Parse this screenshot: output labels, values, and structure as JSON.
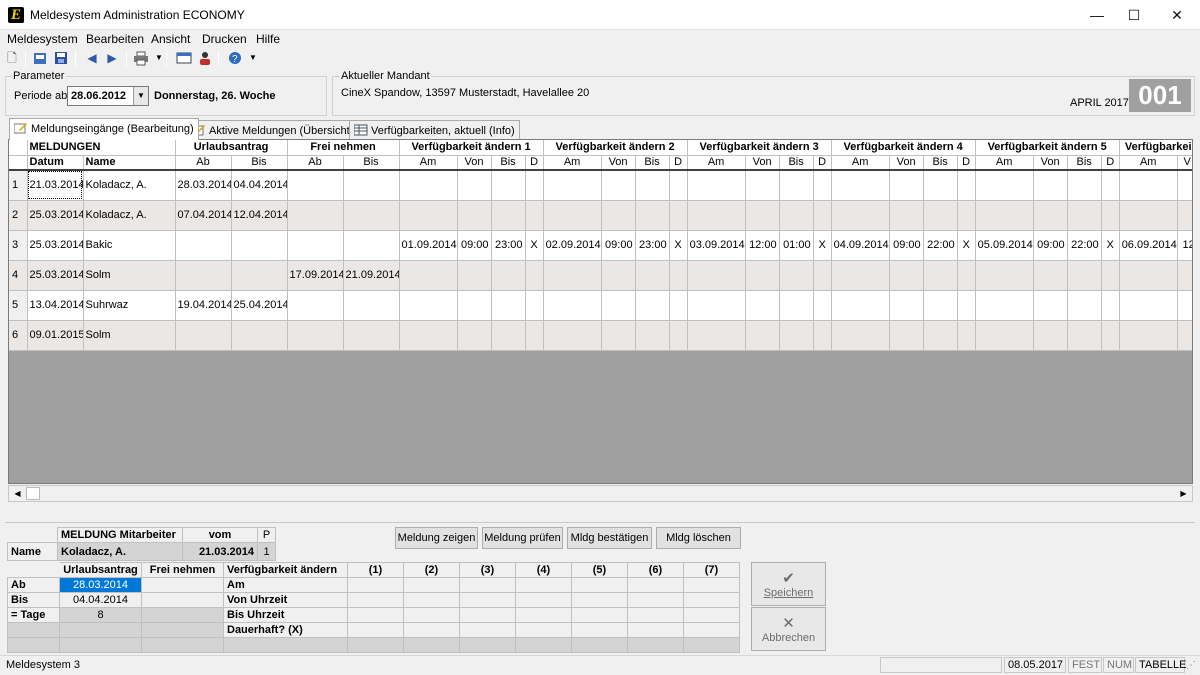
{
  "window": {
    "title": "Meldesystem Administration ECONOMY",
    "logo_letter": "E",
    "min": "—",
    "max": "☐",
    "close": "✕"
  },
  "menu": [
    "Meldesystem",
    "Bearbeiten",
    "Ansicht",
    "Drucken",
    "Hilfe"
  ],
  "parameter": {
    "group_label": "Parameter",
    "periode_label": "Periode ab",
    "periode_value": "28.06.2012",
    "periode_info": "Donnerstag, 26. Woche"
  },
  "mandant": {
    "group_label": "Aktueller Mandant",
    "text": "CineX Spandow, 13597 Musterstadt, Havelallee 20",
    "month": "APRIL 2017",
    "badge": "001"
  },
  "tabs": [
    {
      "label": "Meldungseingänge (Bearbeitung)",
      "active": true
    },
    {
      "label": "Aktive Meldungen (Übersicht)",
      "active": false
    },
    {
      "label": "Verfügbarkeiten, aktuell (Info)",
      "active": false
    }
  ],
  "grid": {
    "group_headers": [
      "MELDUNGEN",
      "Urlaubsantrag",
      "Frei nehmen",
      "Verfügbarkeit ändern 1",
      "Verfügbarkeit ändern 2",
      "Verfügbarkeit ändern 3",
      "Verfügbarkeit ändern 4",
      "Verfügbarkeit ändern 5",
      "Verfügbarkei"
    ],
    "sub_headers": {
      "datum": "Datum",
      "name": "Name",
      "ab": "Ab",
      "bis": "Bis",
      "am": "Am",
      "von": "Von",
      "d": "D",
      "partial": "V"
    },
    "rows": [
      {
        "n": "1",
        "datum": "21.03.2014",
        "name": "Koladacz, A.",
        "u_ab": "28.03.2014",
        "u_bis": "04.04.2014",
        "f_ab": "",
        "f_bis": "",
        "v": []
      },
      {
        "n": "2",
        "datum": "25.03.2014",
        "name": "Koladacz, A.",
        "u_ab": "07.04.2014",
        "u_bis": "12.04.2014",
        "f_ab": "",
        "f_bis": "",
        "v": []
      },
      {
        "n": "3",
        "datum": "25.03.2014",
        "name": "Bakic",
        "u_ab": "",
        "u_bis": "",
        "f_ab": "",
        "f_bis": "",
        "v": [
          [
            "01.09.2014",
            "09:00",
            "23:00",
            "X"
          ],
          [
            "02.09.2014",
            "09:00",
            "23:00",
            "X"
          ],
          [
            "03.09.2014",
            "12:00",
            "01:00",
            "X"
          ],
          [
            "04.09.2014",
            "09:00",
            "22:00",
            "X"
          ],
          [
            "05.09.2014",
            "09:00",
            "22:00",
            "X"
          ],
          [
            "06.09.2014",
            "12",
            "",
            ""
          ]
        ]
      },
      {
        "n": "4",
        "datum": "25.03.2014",
        "name": "Solm",
        "u_ab": "",
        "u_bis": "",
        "f_ab": "17.09.2014",
        "f_bis": "21.09.2014",
        "v": []
      },
      {
        "n": "5",
        "datum": "13.04.2014",
        "name": "Suhrwaz",
        "u_ab": "19.04.2014",
        "u_bis": "25.04.2014",
        "f_ab": "",
        "f_bis": "",
        "v": []
      },
      {
        "n": "6",
        "datum": "09.01.2015",
        "name": "Solm",
        "u_ab": "",
        "u_bis": "",
        "f_ab": "",
        "f_bis": "",
        "v": []
      }
    ]
  },
  "detail": {
    "mitarbeiter_header": "MELDUNG Mitarbeiter",
    "vom_header": "vom",
    "p_header": "P",
    "name_label": "Name",
    "name_value": "Koladacz, A.",
    "vom_value": "21.03.2014",
    "p_value": "1",
    "buttons": [
      "Meldung zeigen",
      "Meldung prüfen",
      "Mldg bestätigen",
      "Mldg löschen"
    ],
    "col_urlaub": "Urlaubsantrag",
    "col_frei": "Frei nehmen",
    "col_verf": "Verfügbarkeit ändern",
    "col_nums": [
      "(1)",
      "(2)",
      "(3)",
      "(4)",
      "(5)",
      "(6)",
      "(7)"
    ],
    "row_ab": "Ab",
    "row_bis": "Bis",
    "row_tage": "= Tage",
    "ab_value": "28.03.2014",
    "bis_value": "04.04.2014",
    "tage_value": "8",
    "verf_rows": [
      "Am",
      "Von Uhrzeit",
      "Bis Uhrzeit",
      "Dauerhaft? (X)"
    ],
    "save_label": "Speichern",
    "cancel_label": "Abbrechen"
  },
  "status": {
    "left": "Meldesystem 3",
    "date": "08.05.2017",
    "fest": "FEST",
    "num": "NUM",
    "tabelle": "TABELLE"
  }
}
